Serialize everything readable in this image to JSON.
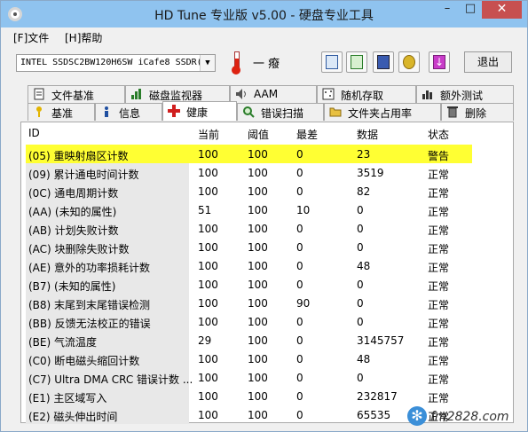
{
  "window": {
    "title": "HD Tune 专业版 v5.00 - 硬盘专业工具"
  },
  "menu": {
    "file": "[F]文件",
    "help": "[H]帮助"
  },
  "toolbar": {
    "drive": "INTEL SSDSC2BW120H6SW iCafe8 SSDR(",
    "temperature": "一 癈",
    "exit_label": "退出",
    "icons": [
      "copy-text-icon",
      "copy-screen-icon",
      "save-icon",
      "options-icon",
      "download-icon"
    ]
  },
  "tabs_top": [
    {
      "label": "文件基准",
      "icon": "file-benchmark-icon"
    },
    {
      "label": "磁盘监视器",
      "icon": "disk-monitor-icon"
    },
    {
      "label": "AAM",
      "icon": "speaker-icon"
    },
    {
      "label": "随机存取",
      "icon": "random-access-icon"
    },
    {
      "label": "额外测试",
      "icon": "extra-tests-icon"
    }
  ],
  "tabs_bottom": [
    {
      "label": "基准",
      "icon": "benchmark-icon"
    },
    {
      "label": "信息",
      "icon": "info-icon"
    },
    {
      "label": "健康",
      "icon": "health-cross-icon",
      "active": true
    },
    {
      "label": "错误扫描",
      "icon": "error-scan-icon"
    },
    {
      "label": "文件夹占用率",
      "icon": "folder-usage-icon"
    },
    {
      "label": "删除",
      "icon": "trash-icon"
    }
  ],
  "health": {
    "columns": [
      "ID",
      "当前",
      "阈值",
      "最差",
      "数据",
      "状态"
    ],
    "rows": [
      {
        "id": "(05) 重映射扇区计数",
        "current": "100",
        "threshold": "100",
        "worst": "0",
        "data": "23",
        "status": "警告",
        "warn": true
      },
      {
        "id": "(09) 累计通电时间计数",
        "current": "100",
        "threshold": "100",
        "worst": "0",
        "data": "3519",
        "status": "正常"
      },
      {
        "id": "(0C) 通电周期计数",
        "current": "100",
        "threshold": "100",
        "worst": "0",
        "data": "82",
        "status": "正常"
      },
      {
        "id": "(AA) (未知的属性)",
        "current": "51",
        "threshold": "100",
        "worst": "10",
        "data": "0",
        "status": "正常"
      },
      {
        "id": "(AB) 计划失败计数",
        "current": "100",
        "threshold": "100",
        "worst": "0",
        "data": "0",
        "status": "正常"
      },
      {
        "id": "(AC) 块删除失败计数",
        "current": "100",
        "threshold": "100",
        "worst": "0",
        "data": "0",
        "status": "正常"
      },
      {
        "id": "(AE) 意外的功率损耗计数",
        "current": "100",
        "threshold": "100",
        "worst": "0",
        "data": "48",
        "status": "正常"
      },
      {
        "id": "(B7) (未知的属性)",
        "current": "100",
        "threshold": "100",
        "worst": "0",
        "data": "0",
        "status": "正常"
      },
      {
        "id": "(B8) 末尾到末尾错误检测",
        "current": "100",
        "threshold": "100",
        "worst": "90",
        "data": "0",
        "status": "正常"
      },
      {
        "id": "(BB) 反馈无法校正的错误",
        "current": "100",
        "threshold": "100",
        "worst": "0",
        "data": "0",
        "status": "正常"
      },
      {
        "id": "(BE) 气流温度",
        "current": "29",
        "threshold": "100",
        "worst": "0",
        "data": "3145757",
        "status": "正常"
      },
      {
        "id": "(C0) 断电磁头缩回计数",
        "current": "100",
        "threshold": "100",
        "worst": "0",
        "data": "48",
        "status": "正常"
      },
      {
        "id": "(C7) Ultra DMA CRC 错误计数 ...",
        "current": "100",
        "threshold": "100",
        "worst": "0",
        "data": "0",
        "status": "正常"
      },
      {
        "id": "(E1) 主区域写入",
        "current": "100",
        "threshold": "100",
        "worst": "0",
        "data": "232817",
        "status": "正常"
      },
      {
        "id": "(E2) 磁头伸出时间",
        "current": "100",
        "threshold": "100",
        "worst": "0",
        "data": "65535",
        "status": "正常"
      }
    ]
  },
  "watermark": {
    "text": "fm2828.com"
  },
  "colors": {
    "titlebar": "#8fc3ef",
    "close": "#c75050",
    "warning_row": "#ffff33",
    "health_icon": "#d01f1f"
  }
}
